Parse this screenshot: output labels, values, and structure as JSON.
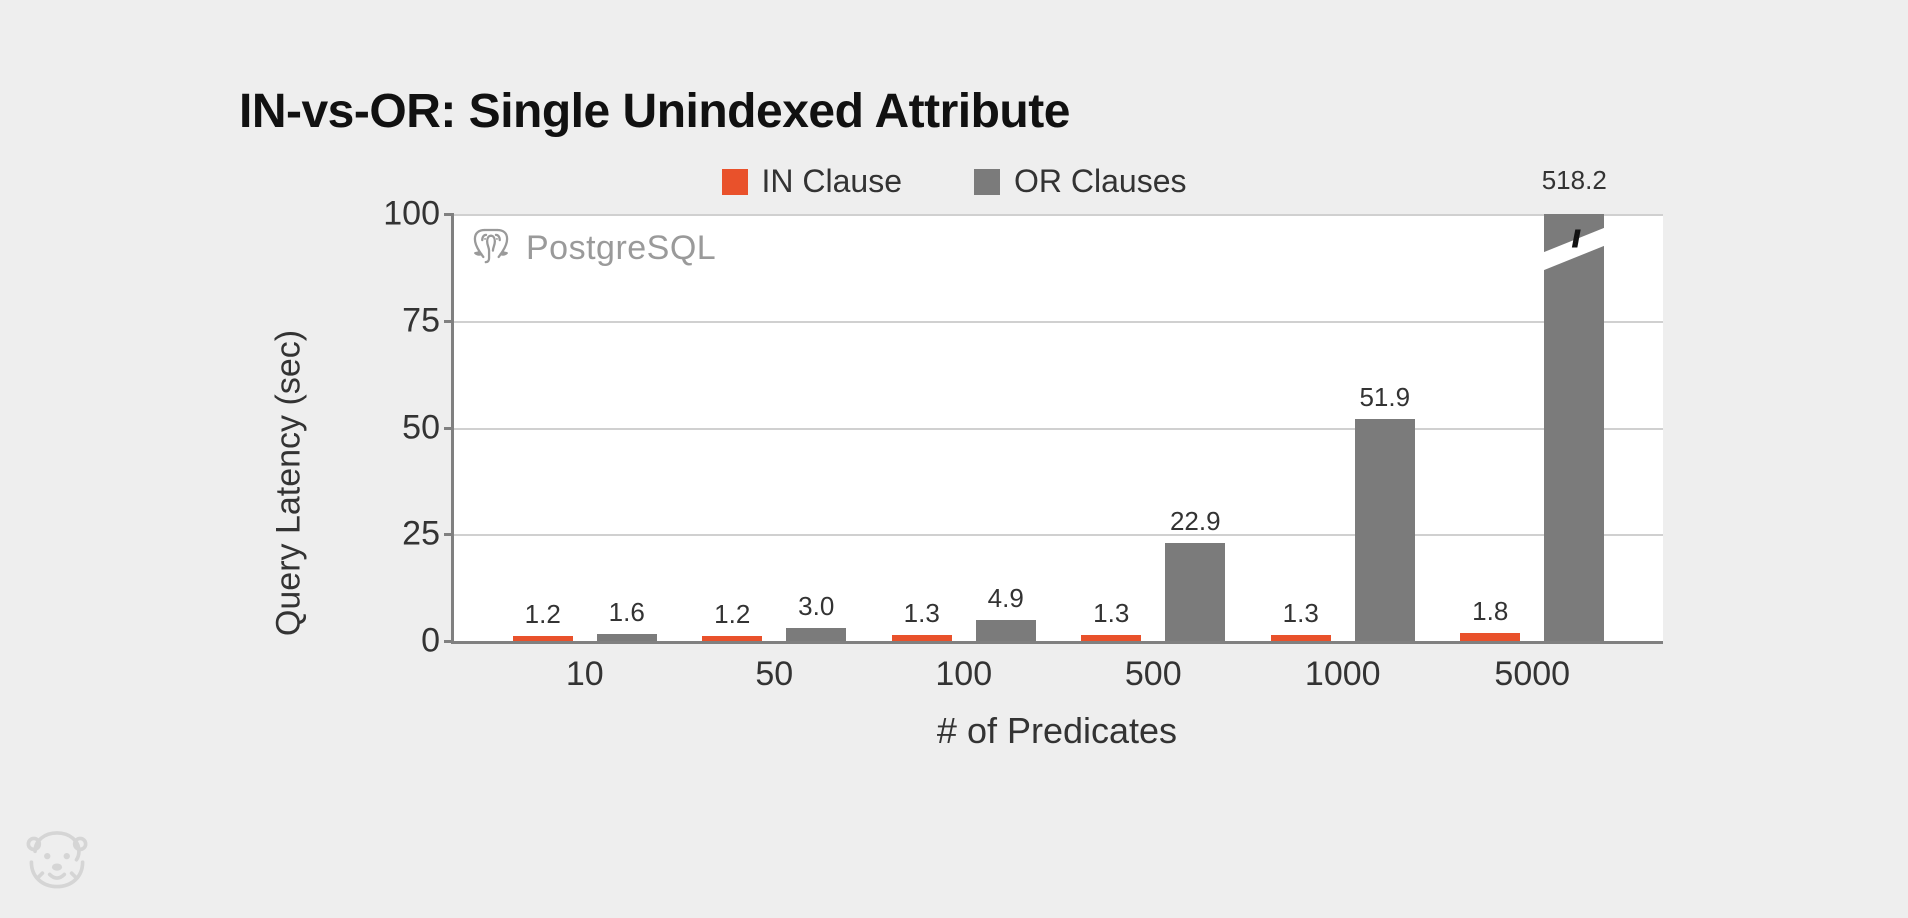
{
  "chart_data": {
    "type": "bar",
    "title": "IN-vs-OR: Single Unindexed Attribute",
    "xlabel": "# of Predicates",
    "ylabel": "Query Latency (sec)",
    "ylim": [
      0,
      100
    ],
    "yticks": [
      0,
      25,
      50,
      75,
      100
    ],
    "categories": [
      "10",
      "50",
      "100",
      "500",
      "1000",
      "5000"
    ],
    "series": [
      {
        "name": "IN Clause",
        "values": [
          1.2,
          1.2,
          1.3,
          1.3,
          1.3,
          1.8
        ]
      },
      {
        "name": "OR Clauses",
        "values": [
          1.6,
          3.0,
          4.9,
          22.9,
          51.9,
          518.2
        ]
      }
    ],
    "legend_position": "top",
    "axis_break": {
      "series": "OR Clauses",
      "category": "5000",
      "displayed_at": 100
    },
    "watermark": "PostgreSQL",
    "colors": {
      "IN Clause": "#e9512b",
      "OR Clauses": "#7b7b7b"
    }
  }
}
